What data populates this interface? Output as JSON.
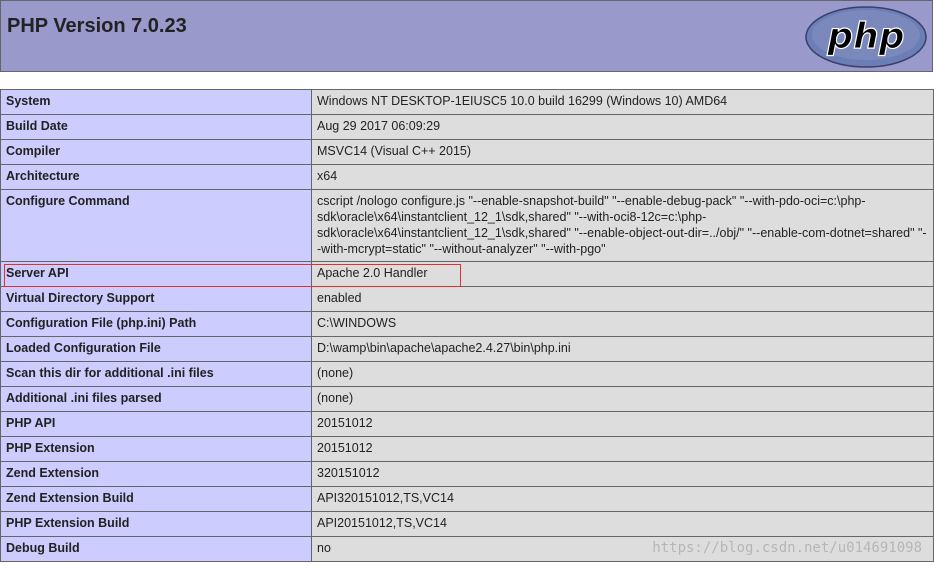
{
  "header": {
    "title": "PHP Version 7.0.23",
    "logo_text": "php"
  },
  "rows": [
    {
      "label": "System",
      "value": "Windows NT DESKTOP-1EIUSC5 10.0 build 16299 (Windows 10) AMD64"
    },
    {
      "label": "Build Date",
      "value": "Aug 29 2017 06:09:29"
    },
    {
      "label": "Compiler",
      "value": "MSVC14 (Visual C++ 2015)"
    },
    {
      "label": "Architecture",
      "value": "x64"
    },
    {
      "label": "Configure Command",
      "value": "cscript /nologo configure.js \"--enable-snapshot-build\" \"--enable-debug-pack\" \"--with-pdo-oci=c:\\php-sdk\\oracle\\x64\\instantclient_12_1\\sdk,shared\" \"--with-oci8-12c=c:\\php-sdk\\oracle\\x64\\instantclient_12_1\\sdk,shared\" \"--enable-object-out-dir=../obj/\" \"--enable-com-dotnet=shared\" \"--with-mcrypt=static\" \"--without-analyzer\" \"--with-pgo\""
    },
    {
      "label": "Server API",
      "value": "Apache 2.0 Handler"
    },
    {
      "label": "Virtual Directory Support",
      "value": "enabled"
    },
    {
      "label": "Configuration File (php.ini) Path",
      "value": "C:\\WINDOWS"
    },
    {
      "label": "Loaded Configuration File",
      "value": "D:\\wamp\\bin\\apache\\apache2.4.27\\bin\\php.ini"
    },
    {
      "label": "Scan this dir for additional .ini files",
      "value": "(none)"
    },
    {
      "label": "Additional .ini files parsed",
      "value": "(none)"
    },
    {
      "label": "PHP API",
      "value": "20151012"
    },
    {
      "label": "PHP Extension",
      "value": "20151012"
    },
    {
      "label": "Zend Extension",
      "value": "320151012"
    },
    {
      "label": "Zend Extension Build",
      "value": "API320151012,TS,VC14"
    },
    {
      "label": "PHP Extension Build",
      "value": "API20151012,TS,VC14"
    },
    {
      "label": "Debug Build",
      "value": "no"
    }
  ],
  "watermark": "https://blog.csdn.net/u014691098",
  "colors": {
    "header_bg": "#9999cc",
    "label_bg": "#ccccff",
    "value_bg": "#dddddd",
    "highlight": "#e03030"
  }
}
